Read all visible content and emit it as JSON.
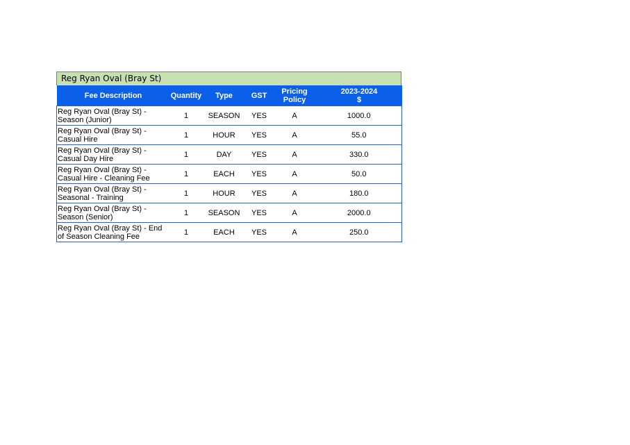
{
  "title": "Reg Ryan Oval (Bray St)",
  "headers": {
    "description": "Fee Description",
    "quantity": "Quantity",
    "type": "Type",
    "gst": "GST",
    "pricing_line1": "Pricing",
    "pricing_line2": "Policy",
    "year_line1": "2023-2024",
    "year_line2": "$"
  },
  "rows": [
    {
      "description": "Reg Ryan Oval (Bray St) - Season (Junior)",
      "quantity": "1",
      "type": "SEASON",
      "gst": "YES",
      "policy": "A",
      "amount": "1000.0"
    },
    {
      "description": "Reg Ryan Oval (Bray St) - Casual Hire",
      "quantity": "1",
      "type": "HOUR",
      "gst": "YES",
      "policy": "A",
      "amount": "55.0"
    },
    {
      "description": "Reg Ryan Oval (Bray St) - Casual Day Hire",
      "quantity": "1",
      "type": "DAY",
      "gst": "YES",
      "policy": "A",
      "amount": "330.0"
    },
    {
      "description": "Reg Ryan Oval (Bray St) - Casual Hire - Cleaning Fee",
      "quantity": "1",
      "type": "EACH",
      "gst": "YES",
      "policy": "A",
      "amount": "50.0"
    },
    {
      "description": "Reg Ryan Oval (Bray St) - Seasonal - Training",
      "quantity": "1",
      "type": "HOUR",
      "gst": "YES",
      "policy": "A",
      "amount": "180.0"
    },
    {
      "description": "Reg Ryan Oval (Bray St) - Season (Senior)",
      "quantity": "1",
      "type": "SEASON",
      "gst": "YES",
      "policy": "A",
      "amount": "2000.0"
    },
    {
      "description": "Reg Ryan Oval (Bray St) - End of Season Cleaning Fee",
      "quantity": "1",
      "type": "EACH",
      "gst": "YES",
      "policy": "A",
      "amount": "250.0"
    }
  ],
  "colors": {
    "title_bg": "#c6e0b4",
    "header_bg": "#0b5fe8",
    "grid": "#1f5fd6"
  }
}
